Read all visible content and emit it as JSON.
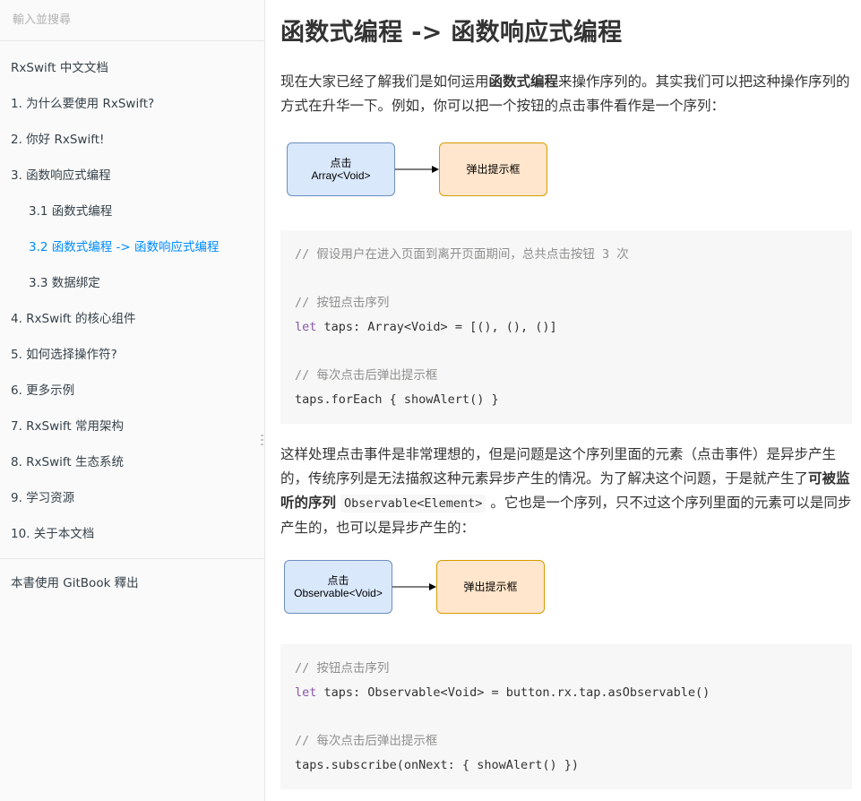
{
  "search": {
    "placeholder": "輸入並搜尋"
  },
  "sidebar": {
    "items": [
      {
        "label": "RxSwift 中文文档"
      },
      {
        "label": "1. 为什么要使用 RxSwift?"
      },
      {
        "label": "2. 你好 RxSwift!"
      },
      {
        "label": "3. 函数响应式编程"
      },
      {
        "label": "3.1 函数式编程"
      },
      {
        "label": "3.2 函数式编程 -> 函数响应式编程"
      },
      {
        "label": "3.3 数据绑定"
      },
      {
        "label": "4. RxSwift 的核心组件"
      },
      {
        "label": "5. 如何选择操作符?"
      },
      {
        "label": "6. 更多示例"
      },
      {
        "label": "7. RxSwift 常用架构"
      },
      {
        "label": "8. RxSwift 生态系统"
      },
      {
        "label": "9. 学习资源"
      },
      {
        "label": "10. 关于本文档"
      }
    ],
    "active_index": 5,
    "footer": "本書使用 GitBook 釋出"
  },
  "colors": {
    "active_link": "#008cff",
    "blue_box": "#dae8fc",
    "orange_box": "#ffe6cc"
  },
  "main": {
    "title": "函数式编程 -> 函数响应式编程",
    "para1": {
      "pre": "现在大家已经了解我们是如何运用",
      "bold": "函数式编程",
      "post": "来操作序列的。其实我们可以把这种操作序列的方式在升华一下。例如，你可以把一个按钮的点击事件看作是一个序列："
    },
    "diagram1": {
      "source_line1": "点击",
      "source_line2": "Array<Void>",
      "target": "弹出提示框"
    },
    "code1": {
      "comment1": "// 假设用户在进入页面到离开页面期间，总共点击按钮 3 次",
      "comment2": "// 按钮点击序列",
      "line1_kw": "let",
      "line1_rest": " taps: Array<Void> = [(), (), ()]",
      "comment3": "// 每次点击后弹出提示框",
      "line2": "taps.forEach { showAlert() }"
    },
    "para2": {
      "pre": "这样处理点击事件是非常理想的，但是问题是这个序列里面的元素（点击事件）是异步产生的，传统序列是无法描叙这种元素异步产生的情况。为了解决这个问题，于是就产生了",
      "bold": "可被监听的序列",
      "code": "Observable<Element>",
      "post": "。它也是一个序列，只不过这个序列里面的元素可以是同步产生的，也可以是异步产生的："
    },
    "diagram2": {
      "source_line1": "点击",
      "source_line2": "Observable<Void>",
      "target": "弹出提示框"
    },
    "code2": {
      "comment1": "// 按钮点击序列",
      "line1_kw": "let",
      "line1_rest": " taps: Observable<Void> = button.rx.tap.asObservable()",
      "comment2": "// 每次点击后弹出提示框",
      "line2": "taps.subscribe(onNext: { showAlert() })"
    }
  }
}
